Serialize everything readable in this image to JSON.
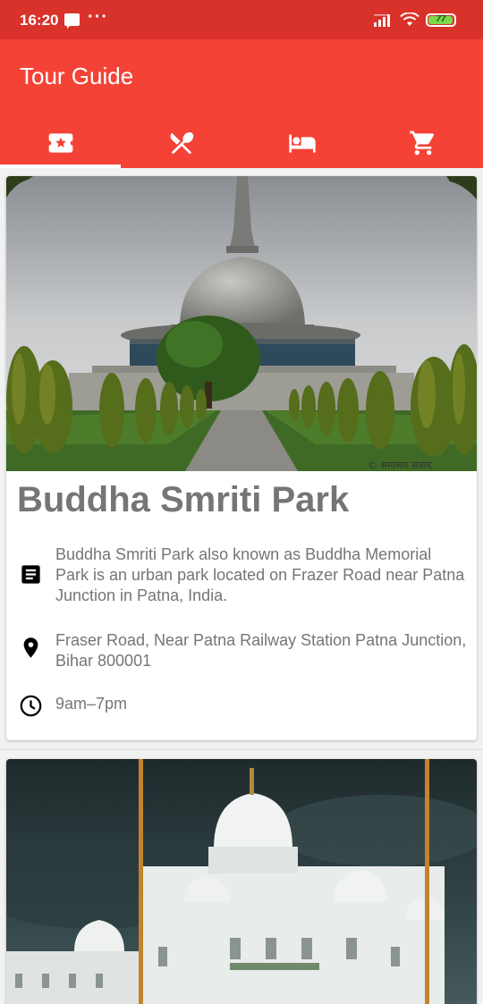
{
  "status_bar": {
    "time": "16:20",
    "more_icon": "···",
    "battery_level": "77",
    "icons": [
      "message-icon",
      "signal-icon",
      "wifi-icon",
      "battery-icon"
    ]
  },
  "app_bar": {
    "title": "Tour Guide",
    "tabs": [
      {
        "icon": "attractions-icon",
        "selected": true
      },
      {
        "icon": "restaurant-icon",
        "selected": false
      },
      {
        "icon": "hotel-icon",
        "selected": false
      },
      {
        "icon": "shopping-cart-icon",
        "selected": false
      }
    ]
  },
  "places": [
    {
      "name": "Buddha Smriti Park",
      "description": "Buddha Smriti Park also known as Buddha Memorial Park is an urban park located on Frazer Road near Patna Junction in Patna, India.",
      "address": "Fraser Road, Near Patna Railway Station Patna Junction, Bihar 800001",
      "hours": "9am–7pm",
      "photo_watermark": "© समाचार संवाद"
    },
    {
      "photo": "white-domed-gurudwara"
    }
  ],
  "colors": {
    "status_bar": "#d9322b",
    "primary": "#f44336",
    "text_secondary": "#757575"
  }
}
